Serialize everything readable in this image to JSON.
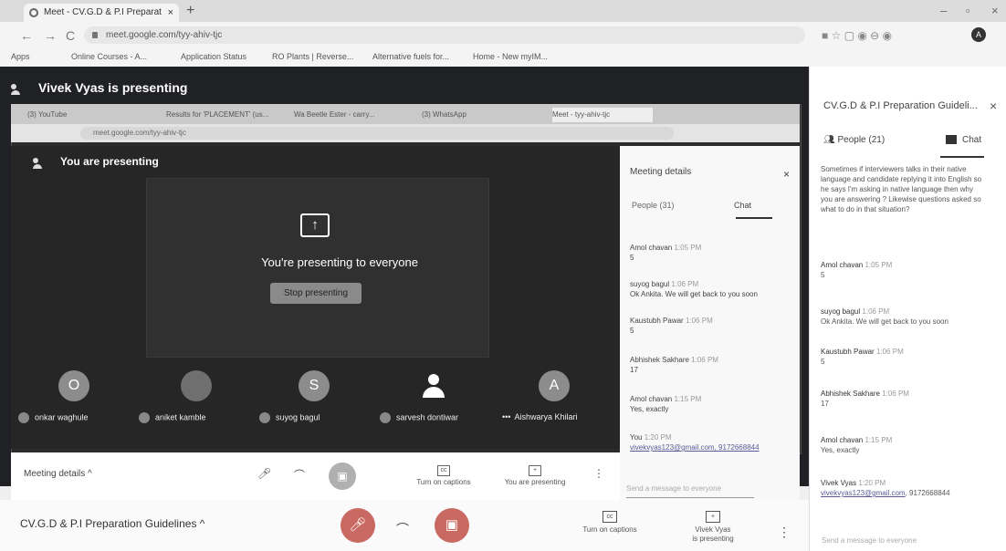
{
  "browser": {
    "tab_title": "Meet - CV.G.D & P.I Preparat",
    "tab_close": "×",
    "new_tab": "+",
    "minimize": "–",
    "restore": "▫",
    "close": "×",
    "back": "←",
    "forward": "→",
    "reload": "C",
    "url": "meet.google.com/tyy-ahiv-tjc",
    "bookmarks": [
      "Apps",
      "Online Courses - A...",
      "Application Status",
      "RO Plants | Reverse...",
      "Alternative fuels for...",
      "Home - New myIM..."
    ]
  },
  "stage": {
    "presenter_banner": "Vivek Vyas is presenting"
  },
  "inner": {
    "tabs": [
      "(3) YouTube",
      "Results for 'PLACEMENT' (us...",
      "Wa Beetle Ester - carry...",
      "(3) WhatsApp",
      "Meet - tyy-ahiv-tjc"
    ],
    "url": "meet.google.com/tyy-ahiv-tjc",
    "presenting_label": "You are presenting",
    "presenting_text": "You're presenting to everyone",
    "stop_button": "Stop presenting",
    "participants": [
      {
        "initial": "O",
        "name": "onkar waghule",
        "color": "#8c8c8c"
      },
      {
        "initial": "",
        "name": "aniket kamble",
        "color": "#6f6f6f"
      },
      {
        "initial": "S",
        "name": "suyog bagul",
        "color": "#8c8c8c"
      },
      {
        "initial": "",
        "name": "sarvesh dontiwar",
        "color": "#262626"
      },
      {
        "initial": "A",
        "name": "Aishwarya Khilari",
        "color": "#8c8c8c"
      }
    ],
    "meeting_details_panel": {
      "title": "Meeting details",
      "people_tab": "People (31)",
      "chat_tab": "Chat",
      "messages": [
        {
          "sender": "Amol chavan",
          "time": "1:05 PM",
          "text": "5"
        },
        {
          "sender": "suyog bagul",
          "time": "1:06 PM",
          "text": "Ok Ankita. We will get back to you soon"
        },
        {
          "sender": "Kaustubh Pawar",
          "time": "1:06 PM",
          "text": "5"
        },
        {
          "sender": "Abhishek Sakhare",
          "time": "1:06 PM",
          "text": "17"
        },
        {
          "sender": "Amol chavan",
          "time": "1:15 PM",
          "text": "Yes, exactly"
        },
        {
          "sender": "You",
          "time": "1:20 PM",
          "text": "vivekvyas123@gmail.com, 9172668844"
        }
      ],
      "input_placeholder": "Send a message to everyone"
    },
    "bar": {
      "meeting_details": "Meeting details  ^",
      "captions": "Turn on captions",
      "presenting": "You are presenting"
    }
  },
  "panel": {
    "title": "CV.G.D & P.I Preparation Guideli...",
    "close": "×",
    "people_tab": "People (21)",
    "chat_tab": "Chat",
    "top_message": "Sometimes if interviewers talks in their native language and candidate replying it into English so he says I'm asking in native language then why you are answering ? Likewise questions asked so what to do in that situation?",
    "messages": [
      {
        "sender": "Amol chavan",
        "time": "1:05 PM",
        "text": "5"
      },
      {
        "sender": "suyog bagul",
        "time": "1:06 PM",
        "text": "Ok Ankita. We will get back to you soon"
      },
      {
        "sender": "Kaustubh Pawar",
        "time": "1:06 PM",
        "text": "5"
      },
      {
        "sender": "Abhishek Sakhare",
        "time": "1:06 PM",
        "text": "17"
      },
      {
        "sender": "Amol chavan",
        "time": "1:15 PM",
        "text": "Yes, exactly"
      }
    ],
    "last_sender": "Vivek Vyas",
    "last_time": "1:20 PM",
    "last_link": "vivekvyas123@gmail.com",
    "last_phone": ", 9172668844",
    "input_placeholder": "Send a message to everyone"
  },
  "bottom": {
    "meeting_title": "CV.G.D & P.I Preparation Guidelines  ^",
    "captions": "Turn on captions",
    "presenting": "Vivek Vyas\nis presenting",
    "more": "⋮"
  },
  "colors": {
    "stage": "#202124",
    "control_red": "#c96a62"
  }
}
